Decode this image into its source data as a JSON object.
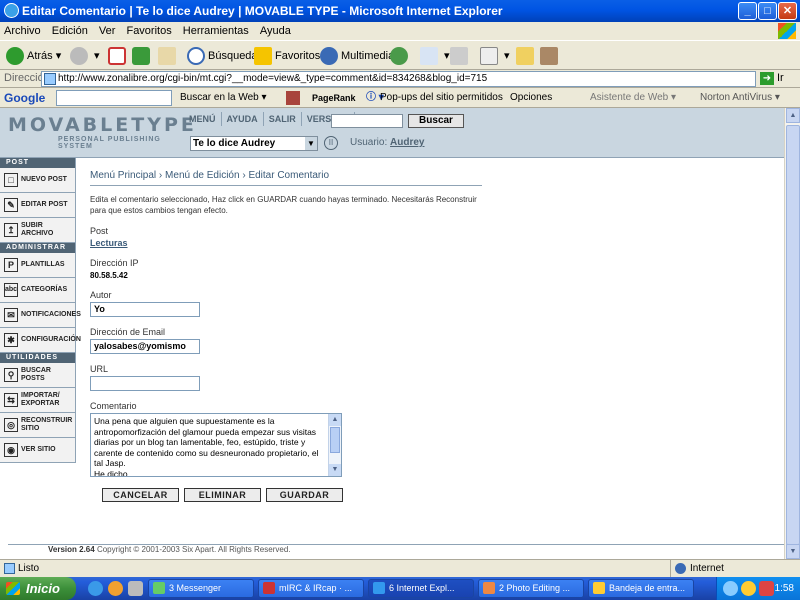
{
  "window": {
    "title": "Editar Comentario | Te lo dice Audrey | MOVABLE TYPE - Microsoft Internet Explorer"
  },
  "menu": [
    "Archivo",
    "Edición",
    "Ver",
    "Favoritos",
    "Herramientas",
    "Ayuda"
  ],
  "toolbar": {
    "back": "Atrás",
    "search": "Búsqueda",
    "favorites": "Favoritos",
    "multimedia": "Multimedia"
  },
  "address": {
    "label": "Dirección",
    "url": "http://www.zonalibre.org/cgi-bin/mt.cgi?__mode=view&_type=comment&id=834268&blog_id=715",
    "go": "Ir"
  },
  "googlebar": {
    "logo": "Google",
    "search_web": "Buscar en la Web",
    "pagerank": "PageRank",
    "popups": "Pop-ups del sitio permitidos",
    "options": "Opciones",
    "assistant": "Asistente de Web",
    "norton": "Norton AntiVirus"
  },
  "mt": {
    "logo": "MOVABLETYPE",
    "logo_sub": "PERSONAL PUBLISHING SYSTEM",
    "nav": [
      "MENÚ",
      "AYUDA",
      "SALIR",
      "VERSITIO"
    ],
    "search_button": "Buscar",
    "blog_select": "Te lo dice Audrey",
    "user_label": "Usuario:",
    "user_name": "Audrey"
  },
  "sidebar": {
    "sections": [
      {
        "title": "POST",
        "items": [
          {
            "label": "NUEVO POST",
            "icon": "□"
          },
          {
            "label": "EDITAR POST",
            "icon": "✎"
          },
          {
            "label": "SUBIR ARCHIVO",
            "icon": "↥"
          }
        ]
      },
      {
        "title": "ADMINISTRAR",
        "items": [
          {
            "label": "PLANTILLAS",
            "icon": "P"
          },
          {
            "label": "CATEGORÍAS",
            "icon": "abc"
          },
          {
            "label": "NOTIFICACIONES",
            "icon": "✉"
          },
          {
            "label": "CONFIGURACIÓN",
            "icon": "✱"
          }
        ]
      },
      {
        "title": "UTILIDADES",
        "items": [
          {
            "label": "BUSCAR POSTS",
            "icon": "⚲"
          },
          {
            "label": "IMPORTAR/ EXPORTAR",
            "icon": "⇆"
          },
          {
            "label": "RECONSTRUIR SITIO",
            "icon": "◎"
          },
          {
            "label": "VER SITIO",
            "icon": "◉"
          }
        ]
      }
    ]
  },
  "main": {
    "breadcrumb": [
      "Menú Principal",
      "Menú de Edición",
      "Editar Comentario"
    ],
    "intro": "Edita el comentario seleccionado, Haz click en GUARDAR cuando hayas terminado. Necesitarás Reconstruir para que estos cambios tengan efecto.",
    "post_label": "Post",
    "post_value": "Lecturas",
    "ip_label": "Dirección IP",
    "ip_value": "80.58.5.42",
    "author_label": "Autor",
    "author_value": "Yo",
    "email_label": "Dirección de Email",
    "email_value": "yalosabes@yomismo",
    "url_label": "URL",
    "url_value": "",
    "comment_label": "Comentario",
    "comment_value": "Una pena que alguien que supuestamente es la antropomorfización del glamour pueda empezar sus visitas diarias por un blog tan lamentable, feo, estúpido, triste y carente de contenido como su desneuronado propietario, el tal Jasp.\nHe dicho.",
    "cancel": "CANCELAR",
    "delete": "ELIMINAR",
    "save": "GUARDAR"
  },
  "footer": {
    "version": "Version 2.64",
    "copyright": "Copyright © 2001-2003 Six Apart. All Rights Reserved."
  },
  "status": {
    "left": "Listo",
    "zone": "Internet"
  },
  "taskbar": {
    "start": "Inicio",
    "tasks": [
      "3 Messenger",
      "mIRC & IRcap · ...",
      "6 Internet Expl...",
      "2 Photo Editing ...",
      "Bandeja de entra..."
    ],
    "clock": "1:58"
  }
}
